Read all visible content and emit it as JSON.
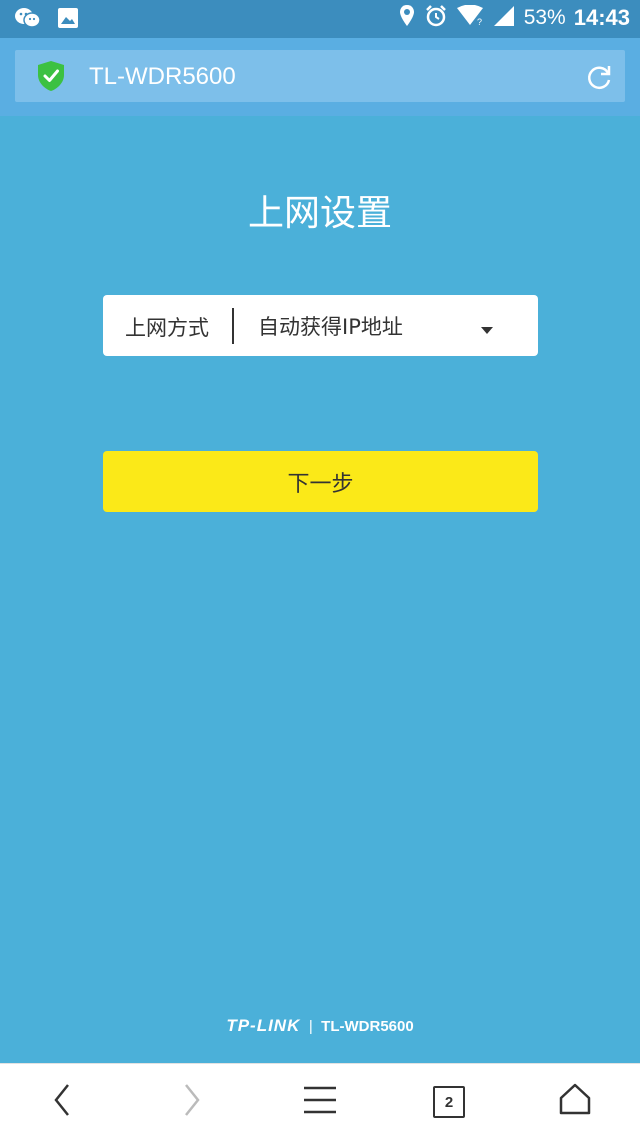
{
  "status_bar": {
    "battery": "53%",
    "time": "14:43",
    "icons": [
      "wechat-icon",
      "image-icon",
      "location-icon",
      "alarm-icon",
      "wifi-icon",
      "signal-icon"
    ]
  },
  "address_bar": {
    "url": "TL-WDR5600",
    "icons": [
      "shield-check-icon",
      "refresh-icon"
    ],
    "shield_color": "#3cc142"
  },
  "main": {
    "title": "上网设置",
    "connection_type": {
      "label": "上网方式",
      "value": "自动获得IP地址"
    },
    "next_button_label": "下一步",
    "button_color": "#fbe918",
    "background_color": "#4bb0d9"
  },
  "footer": {
    "brand": "TP-LINK",
    "separator": "|",
    "model": "TL-WDR5600"
  },
  "nav_bar": {
    "tab_count": "2",
    "icons": [
      "back-icon",
      "forward-icon",
      "menu-icon",
      "tabs-icon",
      "home-icon"
    ]
  }
}
